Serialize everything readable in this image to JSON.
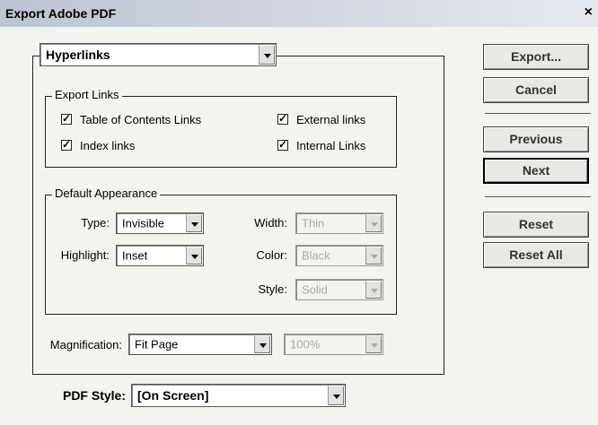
{
  "window": {
    "title": "Export Adobe PDF",
    "close_glyph": "×"
  },
  "panel": {
    "selected": "Hyperlinks"
  },
  "export_links": {
    "legend": "Export Links",
    "items": [
      {
        "label": "Table of Contents Links",
        "checked": true
      },
      {
        "label": "Index links",
        "checked": true
      },
      {
        "label": "External links",
        "checked": true
      },
      {
        "label": "Internal Links",
        "checked": true
      }
    ]
  },
  "appearance": {
    "legend": "Default Appearance",
    "type_label": "Type:",
    "type_value": "Invisible",
    "highlight_label": "Highlight:",
    "highlight_value": "Inset",
    "width_label": "Width:",
    "width_value": "Thin",
    "color_label": "Color:",
    "color_value": "Black",
    "style_label": "Style:",
    "style_value": "Solid"
  },
  "magnification": {
    "label": "Magnification:",
    "value": "Fit Page",
    "zoom": "100%"
  },
  "pdf_style": {
    "label": "PDF Style:",
    "value": "[On Screen]"
  },
  "buttons": {
    "export": "Export...",
    "cancel": "Cancel",
    "previous": "Previous",
    "next": "Next",
    "reset": "Reset",
    "reset_all": "Reset All"
  }
}
